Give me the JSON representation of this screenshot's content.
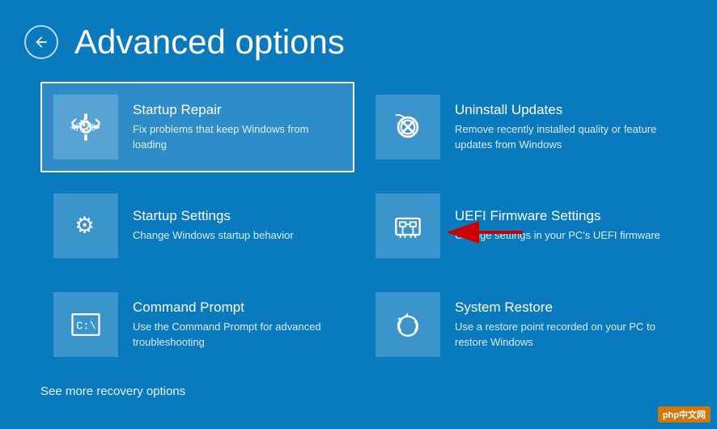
{
  "page": {
    "title": "Advanced options",
    "footer_link": "See more recovery options"
  },
  "options": [
    {
      "id": "startup-repair",
      "title": "Startup Repair",
      "desc": "Fix problems that keep Windows from loading",
      "icon": "repair",
      "selected": true
    },
    {
      "id": "uninstall-updates",
      "title": "Uninstall Updates",
      "desc": "Remove recently installed quality or feature updates from Windows",
      "icon": "uninstall",
      "selected": false
    },
    {
      "id": "startup-settings",
      "title": "Startup Settings",
      "desc": "Change Windows startup behavior",
      "icon": "settings",
      "selected": false
    },
    {
      "id": "uefi-firmware",
      "title": "UEFI Firmware Settings",
      "desc": "Change settings in your PC's UEFI firmware",
      "icon": "uefi",
      "selected": false
    },
    {
      "id": "command-prompt",
      "title": "Command Prompt",
      "desc": "Use the Command Prompt for advanced troubleshooting",
      "icon": "cmd",
      "selected": false
    },
    {
      "id": "system-restore",
      "title": "System Restore",
      "desc": "Use a restore point recorded on your PC to restore Windows",
      "icon": "restore",
      "selected": false
    }
  ],
  "watermark": "php中文网"
}
